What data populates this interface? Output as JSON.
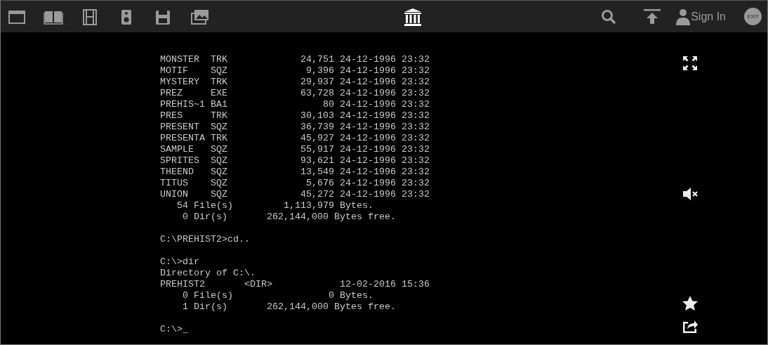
{
  "top_bar": {
    "sign_in": "Sign In",
    "exit": "EXIT"
  },
  "terminal": {
    "blocks": [
      {
        "lines": [
          "MONSTER  TRK             24,751 24-12-1996 23:32",
          "MOTIF    SQZ              9,396 24-12-1996 23:32",
          "MYSTERY  TRK             29,937 24-12-1996 23:32",
          "PREZ     EXE             63,728 24-12-1996 23:32",
          "PREHIS~1 BA1                 80 24-12-1996 23:32",
          "PRES     TRK             30,103 24-12-1996 23:32",
          "PRESENT  SQZ             36,739 24-12-1996 23:32",
          "PRESENTA TRK             45,927 24-12-1996 23:32",
          "SAMPLE   SQZ             55,917 24-12-1996 23:32",
          "SPRITES  SQZ             93,621 24-12-1996 23:32",
          "THEEND   SQZ             13,549 24-12-1996 23:32",
          "TITUS    SQZ              5,676 24-12-1996 23:32",
          "UNION    SQZ             45,272 24-12-1996 23:32",
          "   54 File(s)         1,113,979 Bytes.",
          "    0 Dir(s)       262,144,000 Bytes free."
        ]
      },
      {
        "lines": [
          "C:\\PREHIST2>cd.."
        ]
      },
      {
        "lines": [
          "C:\\>dir",
          "Directory of C:\\.",
          "PREHIST2       <DIR>            12-02-2016 15:36",
          "    0 File(s)                 0 Bytes.",
          "    1 Dir(s)       262,144,000 Bytes free."
        ]
      },
      {
        "lines": [
          "C:\\>_"
        ]
      }
    ]
  }
}
